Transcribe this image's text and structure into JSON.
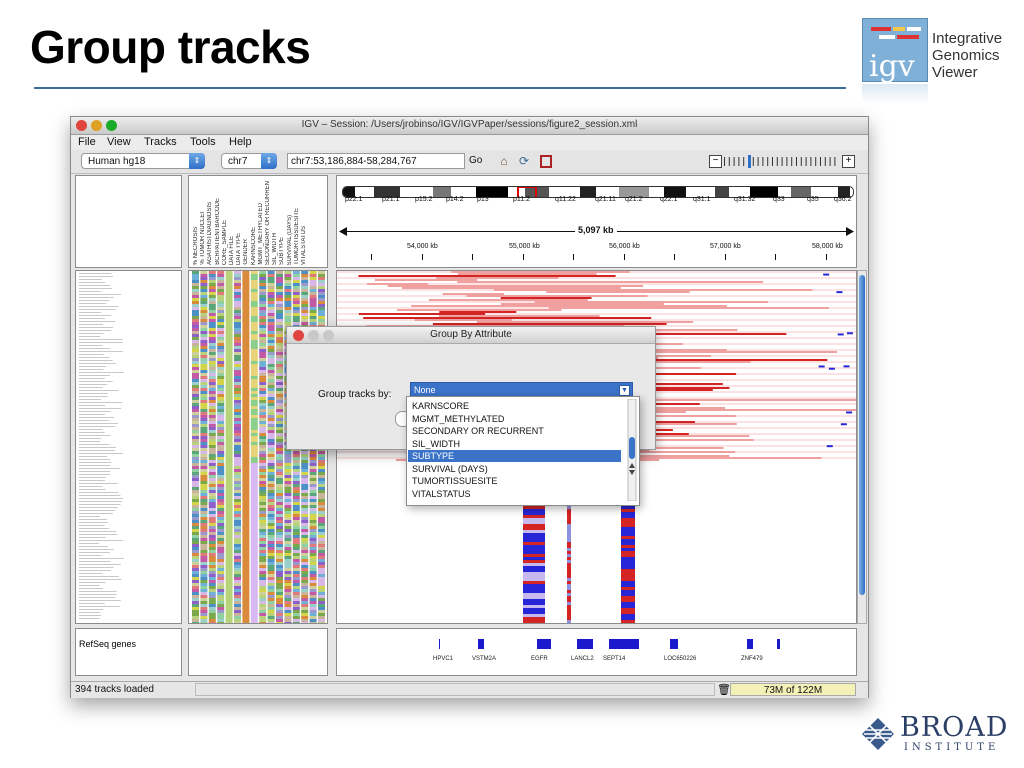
{
  "slide": {
    "title": "Group tracks"
  },
  "logo": {
    "igv": "igv",
    "line1": "Integrative",
    "line2": "Genomics",
    "line3": "Viewer",
    "broad_name": "BROAD",
    "broad_sub": "INSTITUTE"
  },
  "window": {
    "title": "IGV – Session: /Users/jrobinso/IGV/IGVPaper/sessions/figure2_session.xml",
    "menus": [
      "File",
      "View",
      "Tracks",
      "Tools",
      "Help"
    ]
  },
  "toolbar": {
    "genome": "Human hg18",
    "chromosome": "chr7",
    "locus": "chr7:53,186,884-58,284,767",
    "go_label": "Go",
    "home_icon": "home-icon",
    "refresh_icon": "refresh-icon",
    "panel_icon": "region-navigator-icon",
    "zoom_minus": "−",
    "zoom_plus": "+"
  },
  "attributes": [
    "% NECROSIS",
    "% TUMOR NUCLEI",
    "AGATHISTDIAGNOSIS",
    "BCRPATIENTBARCODE",
    "CORE_SAMPLE",
    "DATA FILE",
    "DATA TYPE",
    "GENDER",
    "KARNSCORE",
    "MGMT_METHYLATED",
    "SECONDARY OR RECURREN",
    "SIL_WIDTH",
    "SUBTYPE",
    "SURVIVAL (DAYS)",
    "TUMORTISSUESITE",
    "VITALSTATUS"
  ],
  "ideogram": {
    "bands": [
      "p22.1",
      "p21.1",
      "p15.2",
      "p14.2",
      "p13",
      "p11.2",
      "q11.22",
      "q21.11",
      "q21.2",
      "q22.1",
      "q31.1",
      "q31.32",
      "q33",
      "q35",
      "q36.2"
    ],
    "span": "5,097 kb",
    "ticks": [
      "54,000 kb",
      "55,000 kb",
      "56,000 kb",
      "57,000 kb",
      "58,000 kb"
    ]
  },
  "genes": {
    "track_name": "RefSeq genes",
    "labels": [
      "HPVC1",
      "VSTM2A",
      "EGFR",
      "LANCL2",
      "SEPT14",
      "LOC650226",
      "ZNF479"
    ]
  },
  "status": {
    "tracks_loaded": "394 tracks loaded",
    "memory": "73M of 122M"
  },
  "dialog": {
    "title": "Group By Attribute",
    "label": "Group tracks by:",
    "selected": "None",
    "options": [
      "KARNSCORE",
      "MGMT_METHYLATED",
      "SECONDARY OR RECURRENT",
      "SIL_WIDTH",
      "SUBTYPE",
      "SURVIVAL (DAYS)",
      "TUMORTISSUESITE",
      "VITALSTATUS"
    ],
    "highlighted": "SUBTYPE"
  },
  "colors": {
    "heat_red": "#d42424",
    "heat_blue": "#2626d6",
    "title_rule": "#3c6b9a",
    "memory_bg": "#f3f1b6"
  }
}
